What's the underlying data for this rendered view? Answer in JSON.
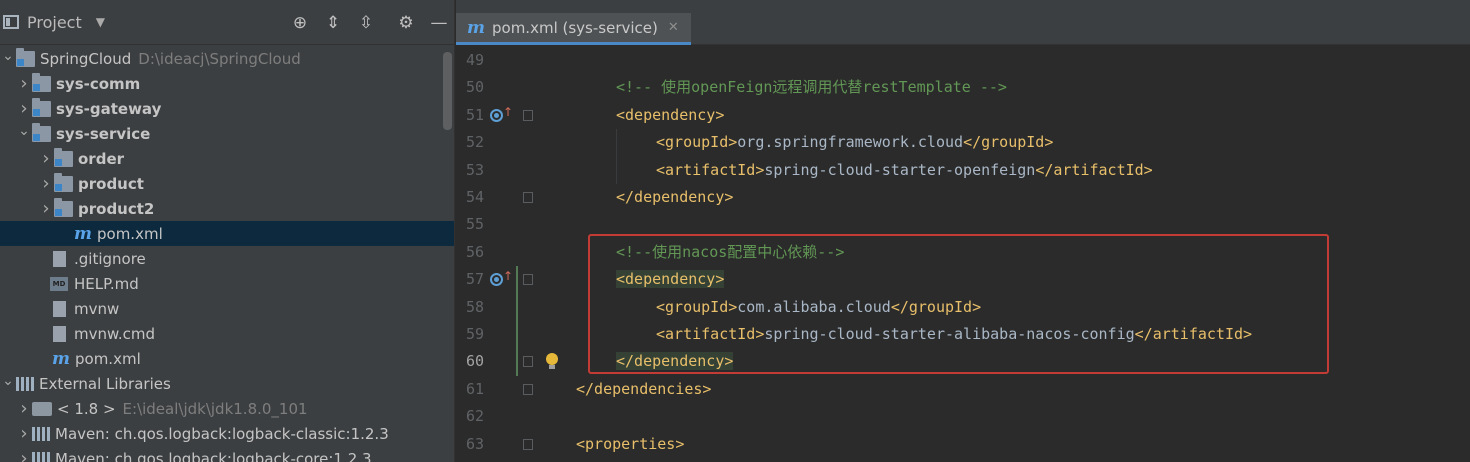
{
  "project_panel": {
    "title": "Project",
    "tree": [
      {
        "label": "SpringCloud",
        "path": "D:\\ideacj\\SpringCloud",
        "icon": "project-folder-icon",
        "arrow": "expanded"
      },
      {
        "label": "sys-comm",
        "icon": "module-folder-icon",
        "arrow": "collapsed"
      },
      {
        "label": "sys-gateway",
        "icon": "module-folder-icon",
        "arrow": "collapsed"
      },
      {
        "label": "sys-service",
        "icon": "module-folder-icon",
        "arrow": "expanded"
      },
      {
        "label": "order",
        "icon": "module-folder-icon",
        "arrow": "collapsed"
      },
      {
        "label": "product",
        "icon": "module-folder-icon",
        "arrow": "collapsed"
      },
      {
        "label": "product2",
        "icon": "module-folder-icon",
        "arrow": "collapsed"
      },
      {
        "label": "pom.xml",
        "icon": "maven-icon",
        "selected": true
      },
      {
        "label": ".gitignore",
        "icon": "gitignore-file-icon"
      },
      {
        "label": "HELP.md",
        "icon": "markdown-file-icon",
        "badge": "MD"
      },
      {
        "label": "mvnw",
        "icon": "text-file-icon"
      },
      {
        "label": "mvnw.cmd",
        "icon": "text-file-icon"
      },
      {
        "label": "pom.xml",
        "icon": "maven-icon"
      },
      {
        "label": "External Libraries",
        "icon": "library-icon",
        "arrow": "expanded"
      },
      {
        "label": "< 1.8 >",
        "path": "E:\\ideal\\jdk\\jdk1.8.0_101",
        "icon": "jdk-icon",
        "arrow": "collapsed"
      },
      {
        "label": "Maven: ch.qos.logback:logback-classic:1.2.3",
        "icon": "library-icon",
        "arrow": "collapsed"
      },
      {
        "label": "Maven: ch.qos.logback:logback-core:1.2.3",
        "icon": "library-icon",
        "arrow": "collapsed"
      }
    ]
  },
  "editor": {
    "tab_label": "pom.xml (sys-service)",
    "lines": [
      {
        "n": "49",
        "parts": []
      },
      {
        "n": "50",
        "indent": 1,
        "parts": [
          {
            "c": "cmt",
            "t": "<!-- 使用openFeign远程调用代替restTemplate -->"
          }
        ]
      },
      {
        "n": "51",
        "indent": 1,
        "parts": [
          {
            "c": "tag",
            "t": "<dependency>"
          }
        ]
      },
      {
        "n": "52",
        "indent": 2,
        "parts": [
          {
            "c": "tag",
            "t": "<groupId>"
          },
          {
            "c": "txt",
            "t": "org.springframework.cloud"
          },
          {
            "c": "tag",
            "t": "</groupId>"
          }
        ]
      },
      {
        "n": "53",
        "indent": 2,
        "parts": [
          {
            "c": "tag",
            "t": "<artifactId>"
          },
          {
            "c": "txt",
            "t": "spring-cloud-starter-openfeign"
          },
          {
            "c": "tag",
            "t": "</artifactId>"
          }
        ]
      },
      {
        "n": "54",
        "indent": 1,
        "parts": [
          {
            "c": "tag",
            "t": "</dependency>"
          }
        ]
      },
      {
        "n": "55",
        "parts": []
      },
      {
        "n": "56",
        "indent": 1,
        "parts": [
          {
            "c": "cmt",
            "t": "<!--使用nacos配置中心依赖-->"
          }
        ]
      },
      {
        "n": "57",
        "indent": 1,
        "parts": [
          {
            "c": "tag hl",
            "t": "<dependency>"
          }
        ]
      },
      {
        "n": "58",
        "indent": 2,
        "parts": [
          {
            "c": "tag",
            "t": "<groupId>"
          },
          {
            "c": "txt",
            "t": "com.alibaba.cloud"
          },
          {
            "c": "tag",
            "t": "</groupId>"
          }
        ]
      },
      {
        "n": "59",
        "indent": 2,
        "parts": [
          {
            "c": "tag",
            "t": "<artifactId>"
          },
          {
            "c": "txt",
            "t": "spring-cloud-starter-alibaba-nacos-config"
          },
          {
            "c": "tag",
            "t": "</artifactId>"
          }
        ]
      },
      {
        "n": "60",
        "indent": 1,
        "current": true,
        "parts": [
          {
            "c": "tag hl",
            "t": "</dependency>"
          }
        ]
      },
      {
        "n": "61",
        "indent": 0,
        "parts": [
          {
            "c": "tag",
            "t": "</dependencies>"
          }
        ]
      },
      {
        "n": "62",
        "parts": []
      },
      {
        "n": "63",
        "indent": 0,
        "parts": [
          {
            "c": "tag",
            "t": "<properties>"
          }
        ]
      }
    ]
  },
  "colors": {
    "tag": "#e8bf6a",
    "comment": "#629755",
    "text": "#a9b7c6",
    "selection": "#0d293e",
    "highlight_box": "#c23b35"
  }
}
